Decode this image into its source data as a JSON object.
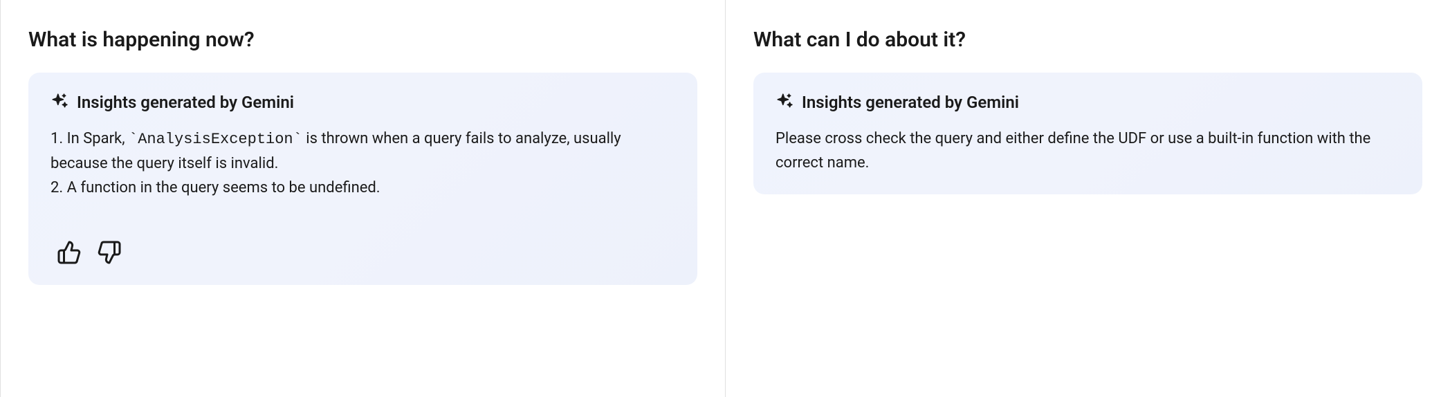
{
  "left": {
    "title": "What is happening now?",
    "card": {
      "header": "Insights generated by Gemini",
      "line1_prefix": "1. In Spark, ",
      "line1_code": "`AnalysisException`",
      "line1_suffix": " is thrown when a query fails to analyze, usually because the query itself is invalid.",
      "line2": "2. A function in the query seems to be undefined."
    }
  },
  "right": {
    "title": "What can I do about it?",
    "card": {
      "header": "Insights generated by Gemini",
      "body": "Please cross check the query and either define the UDF or use a built-in function with the correct name."
    }
  }
}
